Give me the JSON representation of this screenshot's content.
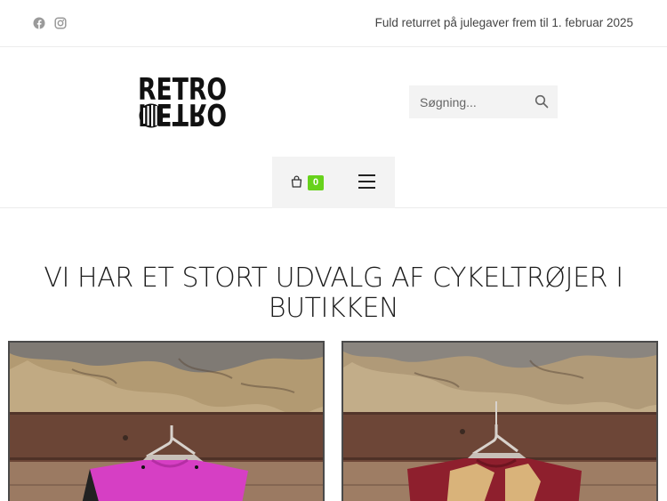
{
  "topbar": {
    "social_icons": [
      "facebook-icon",
      "instagram-icon"
    ],
    "promo_text": "Fuld returret på julegaver frem til 1. februar 2025"
  },
  "header": {
    "logo_text": "RETRO",
    "search": {
      "placeholder": "Søgning..."
    },
    "cart": {
      "count": "0"
    },
    "colors": {
      "badge": "#67d21c",
      "nav_bg": "#f3f3f3"
    }
  },
  "main": {
    "headline": "VI HAR ET STORT UDVALG AF CYKELTRØJER I BUTIKKEN",
    "images": [
      {
        "subject": "pink cycling jersey on hanger against weathered wall"
      },
      {
        "subject": "red and gold cycling jersey on hanger against weathered wall"
      }
    ]
  }
}
